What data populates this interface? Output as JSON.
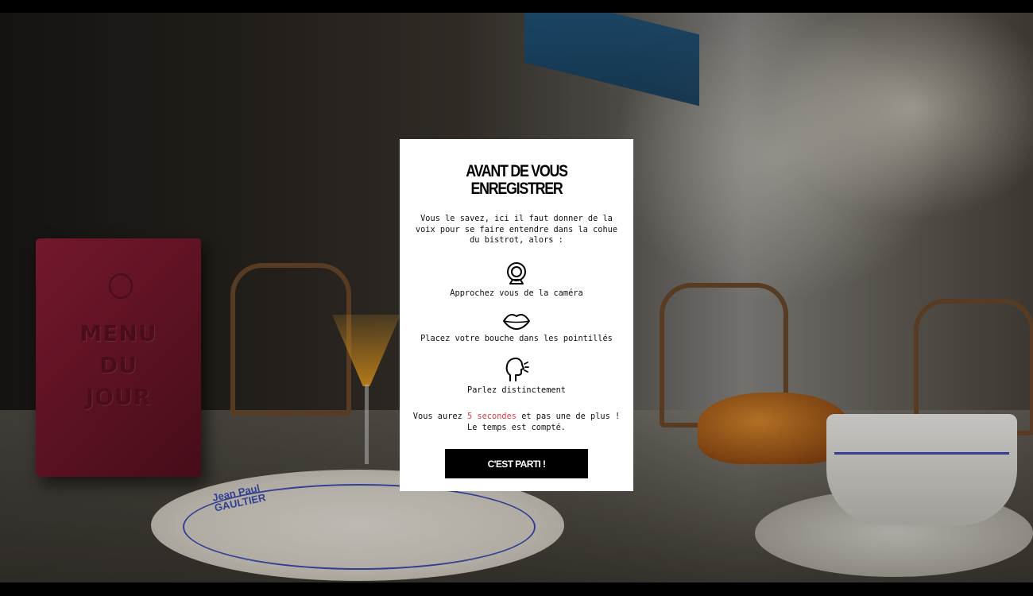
{
  "background": {
    "menu_text": "MENU\nDU\nJOUR",
    "plate_brand": "Jean Paul\nGAULTIER"
  },
  "modal": {
    "title": "AVANT DE VOUS\nENREGISTRER",
    "intro": "Vous le savez, ici il faut donner de la voix pour se faire entendre dans la cohue du bistrot, alors :",
    "steps": [
      {
        "icon": "webcam-icon",
        "label": "Approchez vous de la caméra"
      },
      {
        "icon": "lips-icon",
        "label": "Placez votre bouche dans les pointillés"
      },
      {
        "icon": "speaking-head-icon",
        "label": "Parlez distinctement"
      }
    ],
    "note_before": "Vous aurez ",
    "note_highlight": "5 secondes",
    "note_after": " et pas une de plus !",
    "note_line2": "Le temps est compté.",
    "accent_color": "#e2383e",
    "button_label": "C'EST PARTI !"
  }
}
